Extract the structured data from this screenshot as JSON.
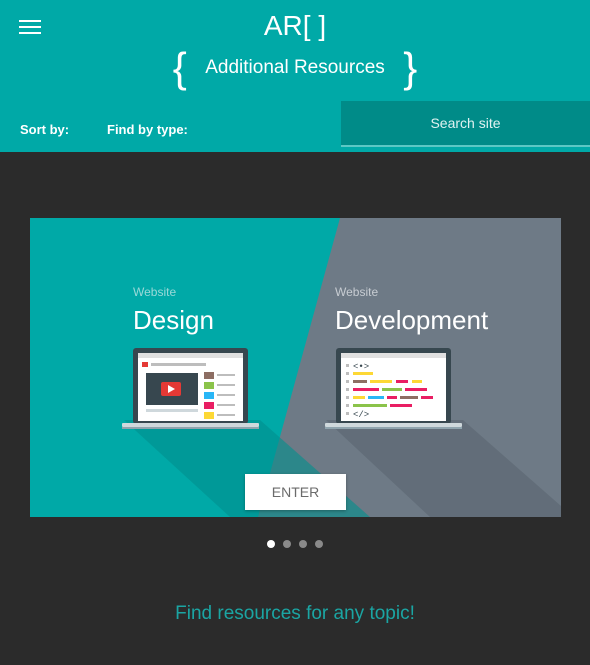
{
  "header": {
    "logo": "AR[ ]",
    "brace_open": "{",
    "subtitle": "Additional Resources",
    "brace_close": "}",
    "sort_label": "Sort by:",
    "find_label": "Find by type:",
    "search_placeholder": "Search site"
  },
  "slide": {
    "left_small": "Website",
    "left_title": "Design",
    "right_small": "Website",
    "right_title": "Development",
    "code_open": "<•>",
    "code_close": "</>",
    "enter_label": "ENTER"
  },
  "carousel": {
    "slide_count": 4,
    "active_index": 0
  },
  "tagline": "Find resources for any topic!",
  "colors": {
    "header": "#00a9a7",
    "background": "#2b2b2b",
    "slate": "#6e7a86",
    "tagline": "#1ba5a3"
  }
}
